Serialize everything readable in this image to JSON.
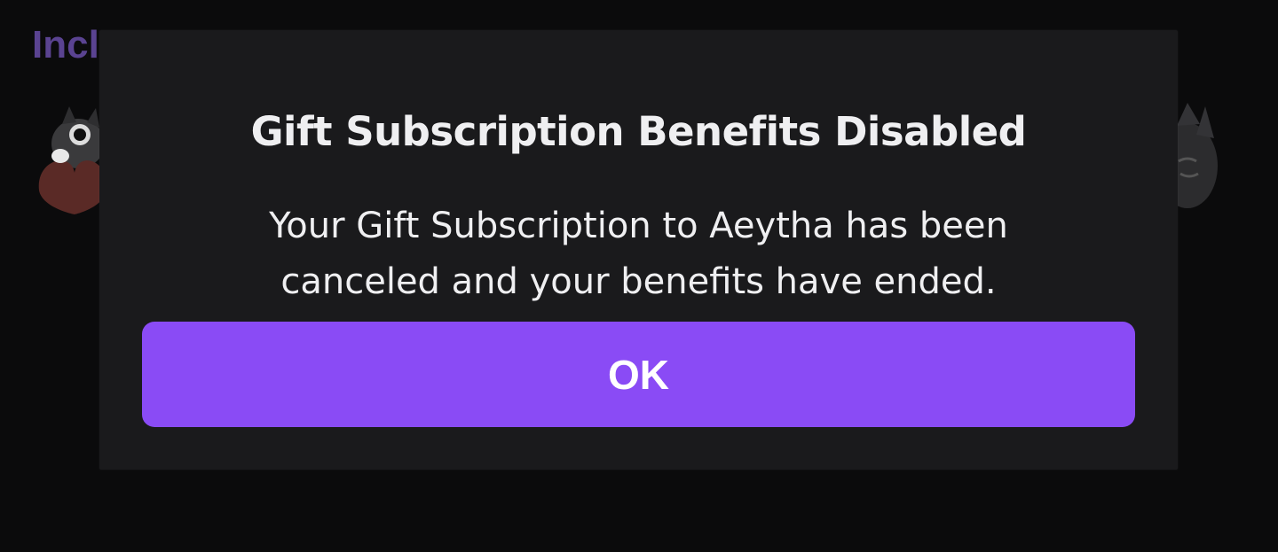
{
  "background": {
    "heading": "Incl",
    "emotes": [
      "heart-emote-icon",
      "grey-cat-emote-icon"
    ]
  },
  "modal": {
    "title": "Gift Subscription Benefits Disabled",
    "message": "Your Gift Subscription to Aeytha has been canceled and your benefits have ended.",
    "ok_label": "OK"
  },
  "colors": {
    "accent": "#8a4bf5",
    "modal_bg": "#1a1a1c",
    "page_bg": "#0b0b0c",
    "text": "#efeff1"
  }
}
